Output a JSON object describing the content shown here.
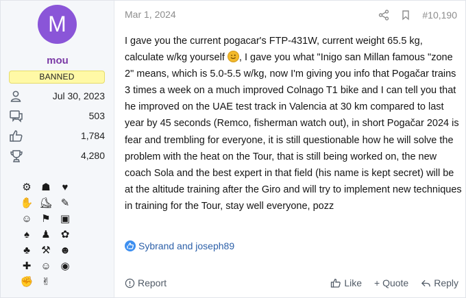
{
  "user": {
    "avatar_letter": "M",
    "avatar_color": "#8a55d8",
    "username": "mou",
    "username_color": "#7b3aa6",
    "badge": "BANNED",
    "badge_color": "#fff9a6",
    "stats": [
      {
        "icon": "user-icon",
        "value": "Jul 30, 2023"
      },
      {
        "icon": "messages-icon",
        "value": "503"
      },
      {
        "icon": "thumbs-up-icon",
        "value": "1,784"
      },
      {
        "icon": "trophy-icon",
        "value": "4,280"
      }
    ],
    "trophy_icons": [
      "bike-icon",
      "cyclists-icon",
      "heart-hands-icon",
      "hand-icon",
      "shoe-icon",
      "wrench-icon",
      "portrait-icon",
      "podium-icon",
      "door-icon",
      "drop-icon",
      "jersey-icon",
      "dog-icon",
      "tulip-icon",
      "hammer-icon",
      "badge-icon",
      "plus-icon",
      "smiley-icon",
      "eye-icon",
      "thumbs-up-icon",
      "hand-heart-icon"
    ],
    "trophy_glyphs": [
      "⚙",
      "☗",
      "♥",
      "✋",
      "⛸",
      "✎",
      "☺",
      "⚑",
      "▣",
      "♠",
      "♟",
      "✿",
      "♣",
      "⚒",
      "☻",
      "✚",
      "☺",
      "◉",
      "✊",
      "✌"
    ]
  },
  "post": {
    "date": "Mar 1, 2024",
    "number": "#10,190",
    "text_before_emoji": "I gave you the current pogacar's FTP-431W, current weight 65.5 kg, calculate w/kg yourself ",
    "text_after_emoji": ", I gave you what \"Inigo san Millan famous \"zone 2\" means, which is 5.0-5.5 w/kg, now I'm giving you info that Pogačar trains 3 times a week on a much improved Colnago T1 bike and I can tell you that he improved on the UAE test track in Valencia at 30 km compared to last year by 45 seconds (Remco, fisherman watch out), in short Pogačar 2024 is fear and trembling for everyone, it is still questionable how he will solve the problem with the heat on the Tour, that is still being worked on, the new coach Sola and the best expert in that field (his name is kept secret) will be at the altitude training after the Giro and will try to implement new techniques in training for the Tour, stay well everyone, pozz",
    "emoji_icon": "wink-emoji-icon",
    "reactions": "Sybrand and joseph89"
  },
  "actions": {
    "report": "Report",
    "like": "Like",
    "quote": "+ Quote",
    "reply": "Reply"
  }
}
